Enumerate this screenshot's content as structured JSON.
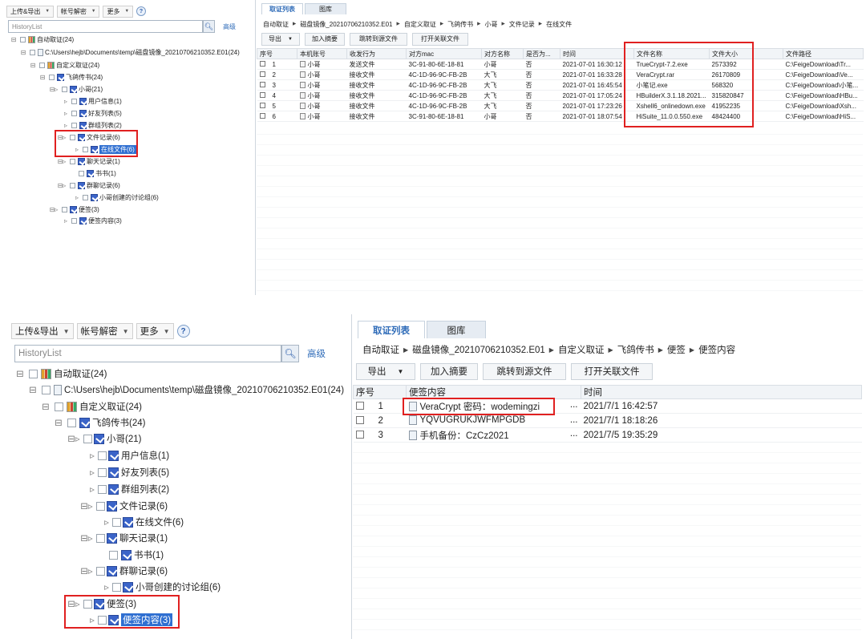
{
  "toolbar": {
    "upload_export": "上传&导出",
    "account_decrypt": "帐号解密",
    "more": "更多",
    "help": "?"
  },
  "search": {
    "placeholder": "HistoryList",
    "advanced": "高级"
  },
  "tabs": {
    "evidence_list": "取证列表",
    "gallery": "图库"
  },
  "buttons": {
    "export": "导出",
    "add_summary": "加入摘要",
    "goto_source": "跳转到源文件",
    "open_related": "打开关联文件"
  },
  "tree": {
    "auto": "自动取证(24)",
    "image_path": "C:\\Users\\hejb\\Documents\\temp\\磁盘镜像_20210706210352.E01(24)",
    "custom": "自定义取证(24)",
    "feige": "飞鸽传书(24)",
    "xiaoge": "小哥(21)",
    "user_info": "用户信息(1)",
    "friends": "好友列表(5)",
    "groups": "群组列表(2)",
    "file_records": "文件记录(6)",
    "online_files": "在线文件(6)",
    "chat_records": "聊天记录(1)",
    "shushu": "书书(1)",
    "group_chat": "群聊记录(6)",
    "discussion": "小哥创建的讨论组(6)",
    "notes": "便签(3)",
    "notes_content": "便签内容(3)"
  },
  "top_crumbs": [
    "自动取证",
    "磁盘镜像_20210706210352.E01",
    "自定义取证",
    "飞鸽传书",
    "小哥",
    "文件记录",
    "在线文件"
  ],
  "bottom_crumbs": [
    "自动取证",
    "磁盘镜像_20210706210352.E01",
    "自定义取证",
    "飞鸽传书",
    "便签",
    "便签内容"
  ],
  "top_table": {
    "columns": [
      "序号",
      "本机账号",
      "收发行为",
      "对方mac",
      "对方名称",
      "是否为...",
      "时间",
      "文件名称",
      "文件大小",
      "文件路径"
    ],
    "rows": [
      [
        "1",
        "小哥",
        "发送文件",
        "3C-91-80-6E-18-81",
        "小哥",
        "否",
        "2021-07-01 16:30:12",
        "TrueCrypt-7.2.exe",
        "2573392",
        "C:\\FeigeDownload\\Tr..."
      ],
      [
        "2",
        "小哥",
        "接收文件",
        "4C-1D-96-9C-FB-2B",
        "大飞",
        "否",
        "2021-07-01 16:33:28",
        "VeraCrypt.rar",
        "26170809",
        "C:\\FeigeDownload\\Ve..."
      ],
      [
        "3",
        "小哥",
        "接收文件",
        "4C-1D-96-9C-FB-2B",
        "大飞",
        "否",
        "2021-07-01 16:45:54",
        "小笔记.exe",
        "568320",
        "C:\\FeigeDownload\\小笔..."
      ],
      [
        "4",
        "小哥",
        "接收文件",
        "4C-1D-96-9C-FB-2B",
        "大飞",
        "否",
        "2021-07-01 17:05:24",
        "HBuilderX.3.1.18.2021...",
        "315820847",
        "C:\\FeigeDownload\\HBu..."
      ],
      [
        "5",
        "小哥",
        "接收文件",
        "4C-1D-96-9C-FB-2B",
        "大飞",
        "否",
        "2021-07-01 17:23:26",
        "Xshell6_onlinedown.exe",
        "41952235",
        "C:\\FeigeDownload\\Xsh..."
      ],
      [
        "6",
        "小哥",
        "接收文件",
        "3C-91-80-6E-18-81",
        "小哥",
        "否",
        "2021-07-01 18:07:54",
        "HiSuite_11.0.0.550.exe",
        "48424400",
        "C:\\FeigeDownload\\HiS..."
      ]
    ]
  },
  "bottom_table": {
    "columns": [
      "序号",
      "便签内容",
      "时间"
    ],
    "rows": [
      [
        "1",
        "VeraCrypt 密码：wodemingzi",
        "...",
        "2021/7/1 16:42:57"
      ],
      [
        "2",
        "YQVUGRUKJWFMPGDB",
        "...",
        "2021/7/1 18:18:26"
      ],
      [
        "3",
        "手机备份：CzCz2021",
        "...",
        "2021/7/5 19:35:29"
      ]
    ]
  },
  "colors": {
    "accent": "#2e6bb8",
    "highlight_box": "#e02020",
    "selection": "#2f6fd1"
  }
}
